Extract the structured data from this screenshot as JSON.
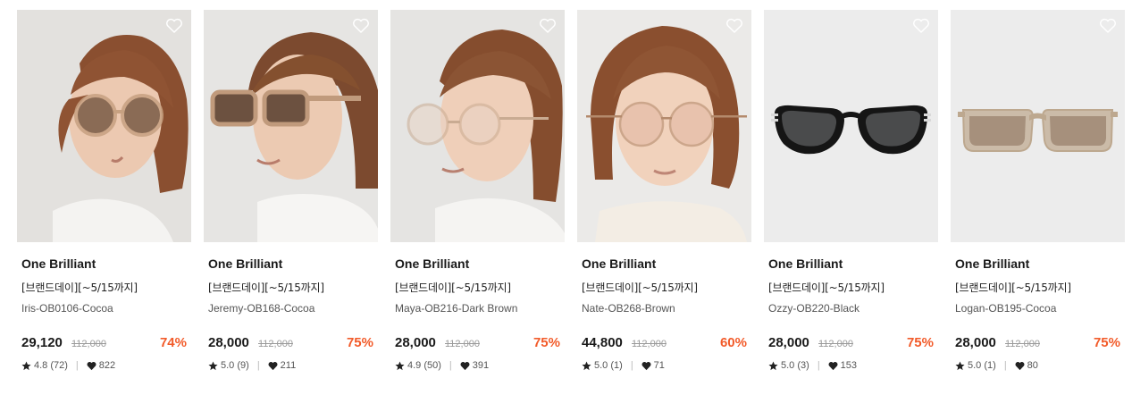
{
  "products": [
    {
      "brand": "One Brilliant",
      "promo": "[브랜드데이][~5/15까지]",
      "name": "Iris-OB0106-Cocoa",
      "price": "29,120",
      "original_price": "112,000",
      "discount": "74%",
      "rating": "4.8",
      "reviews": "(72)",
      "likes": "822",
      "image": "model-round-cocoa-tinted"
    },
    {
      "brand": "One Brilliant",
      "promo": "[브랜드데이][~5/15까지]",
      "name": "Jeremy-OB168-Cocoa",
      "price": "28,000",
      "original_price": "112,000",
      "discount": "75%",
      "rating": "5.0",
      "reviews": "(9)",
      "likes": "211",
      "image": "model-square-cocoa-side"
    },
    {
      "brand": "One Brilliant",
      "promo": "[브랜드데이][~5/15까지]",
      "name": "Maya-OB216-Dark Brown",
      "price": "28,000",
      "original_price": "112,000",
      "discount": "75%",
      "rating": "4.9",
      "reviews": "(50)",
      "likes": "391",
      "image": "model-clear-round-frame"
    },
    {
      "brand": "One Brilliant",
      "promo": "[브랜드데이][~5/15까지]",
      "name": "Nate-OB268-Brown",
      "price": "44,800",
      "original_price": "112,000",
      "discount": "60%",
      "rating": "5.0",
      "reviews": "(1)",
      "likes": "71",
      "image": "model-metal-round-frame"
    },
    {
      "brand": "One Brilliant",
      "promo": "[브랜드데이][~5/15까지]",
      "name": "Ozzy-OB220-Black",
      "price": "28,000",
      "original_price": "112,000",
      "discount": "75%",
      "rating": "5.0",
      "reviews": "(3)",
      "likes": "153",
      "image": "product-black-sunglasses"
    },
    {
      "brand": "One Brilliant",
      "promo": "[브랜드데이][~5/15까지]",
      "name": "Logan-OB195-Cocoa",
      "price": "28,000",
      "original_price": "112,000",
      "discount": "75%",
      "rating": "5.0",
      "reviews": "(1)",
      "likes": "80",
      "image": "product-beige-sunglasses"
    }
  ],
  "colors": {
    "discount": "#f25b2a",
    "text": "#1a1a1a",
    "muted": "#9a9a9a",
    "photo_bg": "#ececec"
  },
  "icons": {
    "wishlist": "heart-outline-icon",
    "rating": "star-icon",
    "likes": "heart-filled-icon"
  }
}
